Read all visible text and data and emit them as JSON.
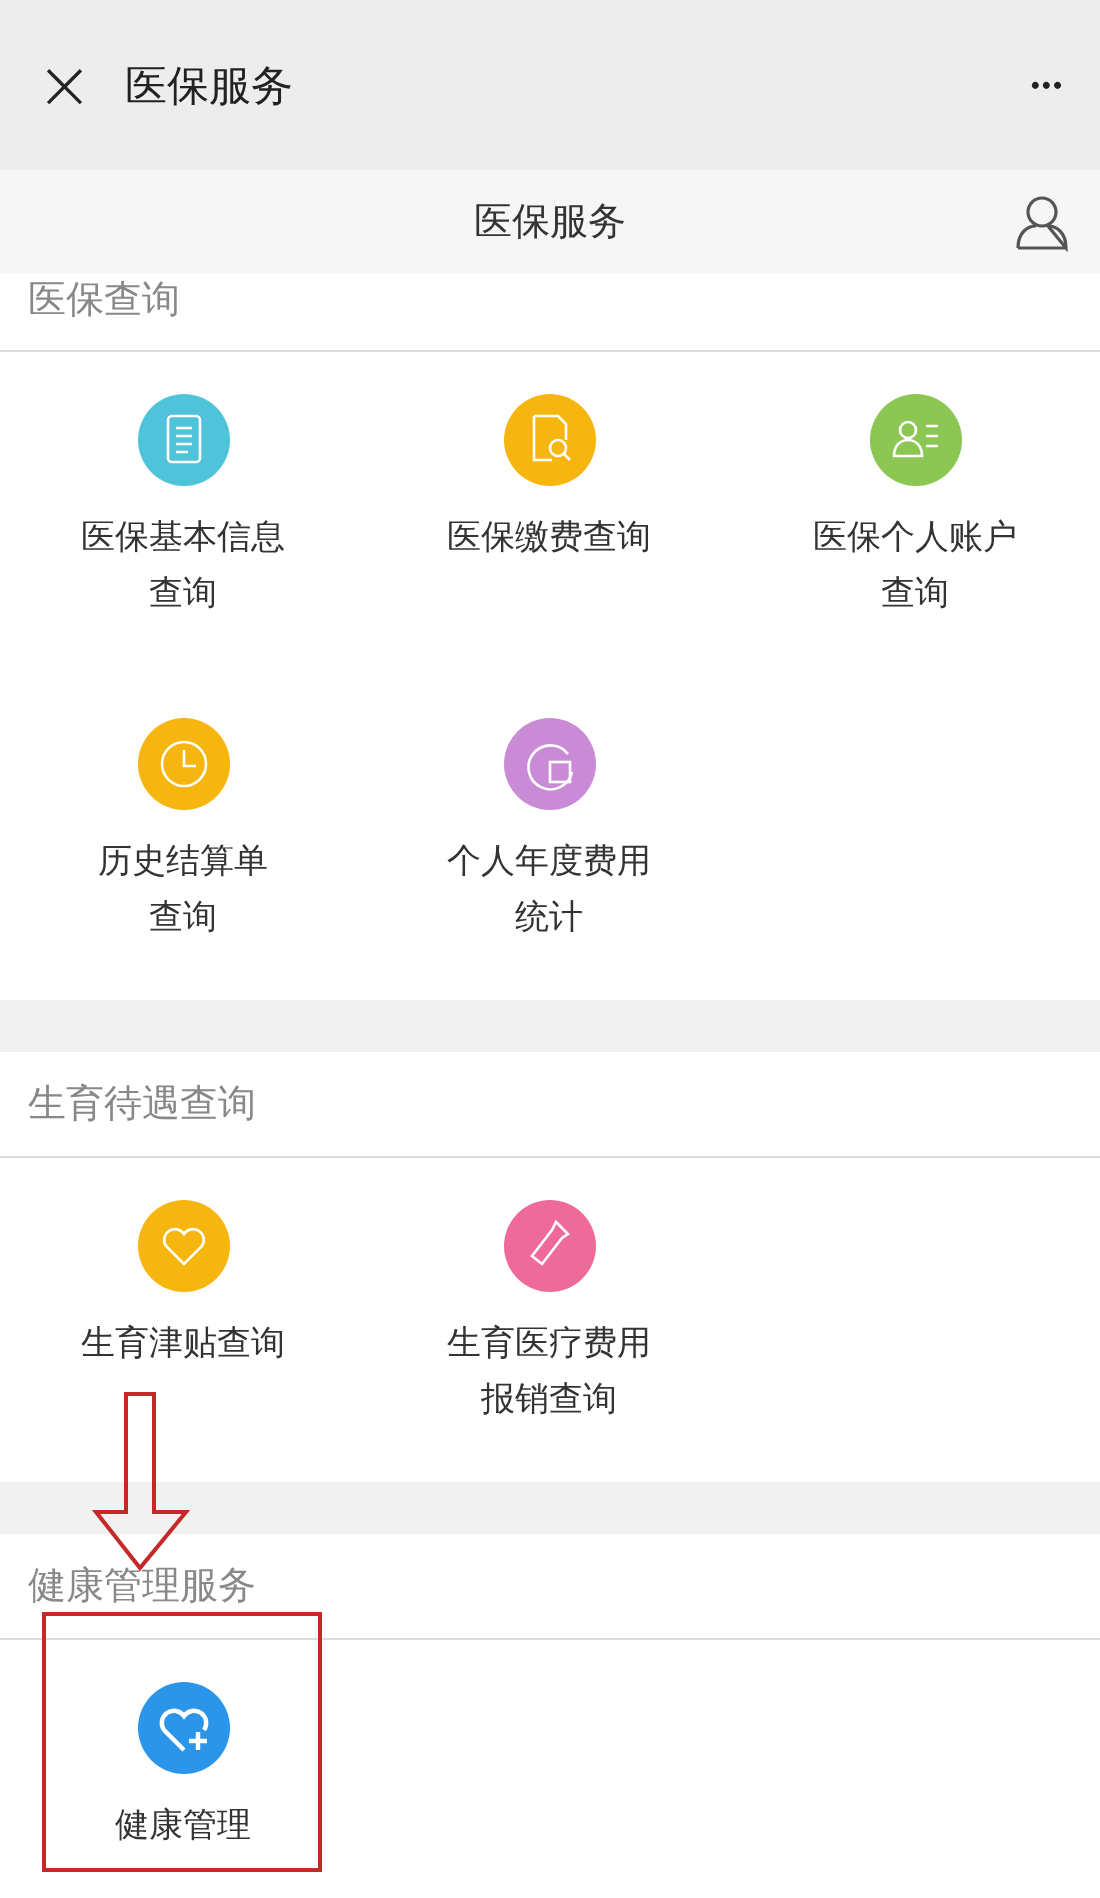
{
  "top_bar": {
    "close": "×",
    "title": "医保服务",
    "more": "•••"
  },
  "header": {
    "title": "医保服务"
  },
  "sections": [
    {
      "title": "医保查询",
      "items": [
        {
          "label_lines": [
            "医保基本信息",
            "查询"
          ],
          "color": "#4fc3d9",
          "highlighted": false
        },
        {
          "label_lines": [
            "医保缴费查询"
          ],
          "color": "#f6b60f",
          "highlighted": false
        },
        {
          "label_lines": [
            "医保个人账户",
            "查询"
          ],
          "color": "#8cc653",
          "highlighted": false
        },
        {
          "label_lines": [
            "历史结算单",
            "查询"
          ],
          "color": "#f6b60f",
          "highlighted": false
        },
        {
          "label_lines": [
            "个人年度费用",
            "统计"
          ],
          "color": "#c98ad6",
          "highlighted": false
        }
      ]
    },
    {
      "title": "生育待遇查询",
      "items": [
        {
          "label_lines": [
            "生育津贴查询"
          ],
          "color": "#f6b60f",
          "highlighted": false
        },
        {
          "label_lines": [
            "生育医疗费用",
            "报销查询"
          ],
          "color": "#ee6a9a",
          "highlighted": false
        }
      ]
    },
    {
      "title": "健康管理服务",
      "items": [
        {
          "label_lines": [
            "健康管理"
          ],
          "color": "#2b95e9",
          "highlighted": true
        }
      ]
    }
  ]
}
